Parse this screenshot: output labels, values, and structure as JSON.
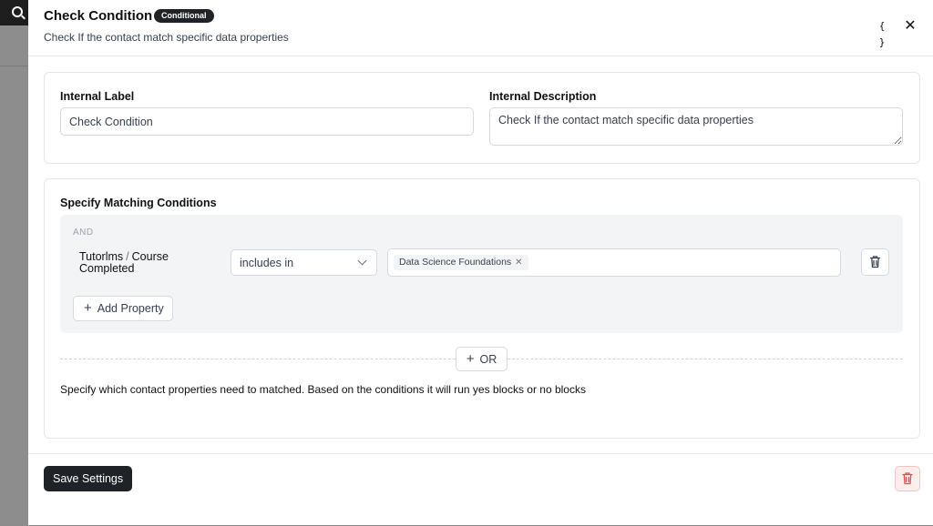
{
  "header": {
    "title": "Check Condition",
    "badge": "Conditional",
    "subtitle": "Check If the contact match specific data properties",
    "code_icon_text": "{ }",
    "close_icon_text": "✕"
  },
  "general": {
    "label_title": "Internal Label",
    "label_value": "Check Condition",
    "description_title": "Internal Description",
    "description_value": "Check If the contact match specific data properties"
  },
  "conditions": {
    "title": "Specify Matching Conditions",
    "group_operator": "AND",
    "rows": [
      {
        "property_source": "Tutorlms",
        "separator": "/",
        "property_name": "Course Completed",
        "operator": "includes in",
        "values": [
          "Data Science Foundations"
        ]
      }
    ],
    "add_property_label": "Add Property",
    "or_label": "OR",
    "help_text": "Specify which contact properties need to matched. Based on the conditions it will run yes blocks or no blocks"
  },
  "footer": {
    "save_label": "Save Settings"
  },
  "colors": {
    "primary": "#1f2328",
    "danger": "#e05252",
    "muted_bg": "#f3f4f6"
  },
  "icons": [
    "search-icon",
    "code-braces-icon",
    "close-icon",
    "chevron-down-icon",
    "trash-icon",
    "plus-icon",
    "remove-tag-icon"
  ]
}
